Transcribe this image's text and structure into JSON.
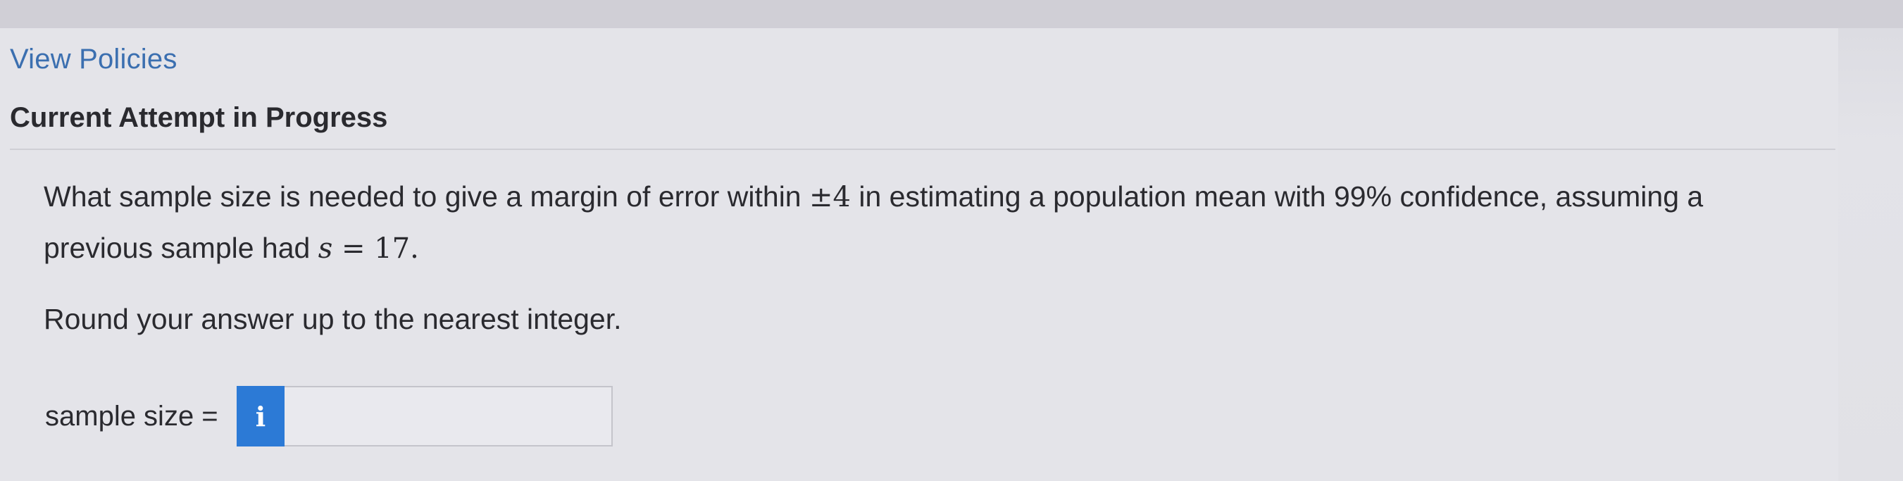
{
  "header": {
    "view_policies": "View Policies",
    "attempt_status": "Current Attempt in Progress"
  },
  "question": {
    "text_before_pm": "What sample size is needed to give a margin of error within ",
    "pm_value": "±4",
    "text_after_pm": " in estimating a population mean with 99% confidence, assuming a previous sample had ",
    "s_var": "s",
    "s_eq": " = 17.",
    "instruction": "Round your answer up to the nearest integer."
  },
  "answer": {
    "label": "sample size =",
    "info_icon": "i",
    "value": ""
  },
  "colors": {
    "link": "#3b6fb0",
    "info_button": "#2c7ad6"
  }
}
